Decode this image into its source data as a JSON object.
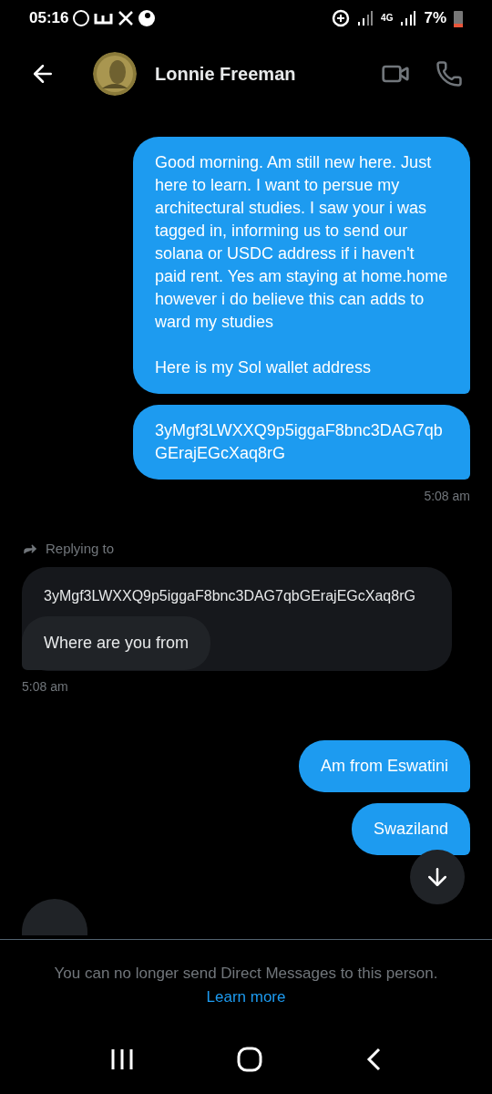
{
  "status_bar": {
    "time": "05:16",
    "network": "4G",
    "battery": "7%"
  },
  "header": {
    "name": "Lonnie Freeman"
  },
  "messages": [
    {
      "kind": "sent",
      "text": "Good morning.  Am still new here. Just here to learn. I want to persue my architectural  studies. I saw your i was tagged in, informing  us to send our solana or USDC address  if i haven't  paid rent. Yes am staying at home.home however i do believe this can adds to ward my studies\n\nHere is my Sol wallet address"
    },
    {
      "kind": "sent",
      "text": "3yMgf3LWXXQ9p5iggaF8bnc3DAG7qbGErajEGcXaq8rG",
      "time": "5:08 am"
    },
    {
      "kind": "reply",
      "label": "Replying to",
      "quoted": "3yMgf3LWXXQ9p5iggaF8bnc3DAG7qbGErajEGcXaq8rG",
      "text": "Where are you from",
      "time": "5:08 am"
    },
    {
      "kind": "sent",
      "text": "Am from Eswatini"
    },
    {
      "kind": "sent",
      "text": "Swaziland"
    },
    {
      "kind": "partial"
    }
  ],
  "footer": {
    "notice": "You can no longer send Direct Messages to this person.",
    "link": "Learn more"
  }
}
